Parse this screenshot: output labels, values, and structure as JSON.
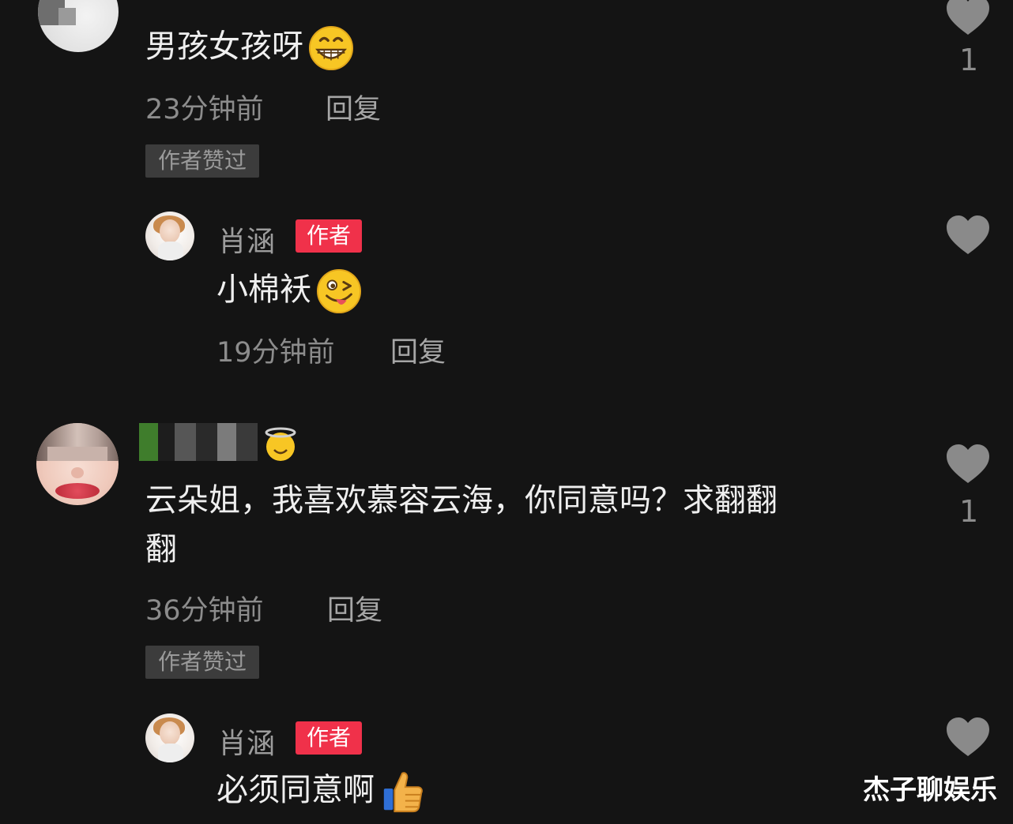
{
  "colors": {
    "background": "#141414",
    "author_badge": "#f0314a",
    "liked_badge": "#3c3c3c",
    "heart": "#8a8a8a"
  },
  "comments": [
    {
      "text": "男孩女孩呀",
      "emoji": "grinning-face-emoji",
      "time": "23分钟前",
      "reply_label": "回复",
      "liked_badge": "作者赞过",
      "like_count": "1"
    },
    {
      "name": "肖涵",
      "author_badge": "作者",
      "text": "小棉袄",
      "emoji": "winking-tongue-face-emoji",
      "time": "19分钟前",
      "reply_label": "回复"
    },
    {
      "text_line1": "云朵姐，我喜欢慕容云海，你同意吗？求翻翻",
      "text_line2": "翻",
      "time": "36分钟前",
      "reply_label": "回复",
      "liked_badge": "作者赞过",
      "like_count": "1"
    },
    {
      "name": "肖涵",
      "author_badge": "作者",
      "text": "必须同意啊",
      "emoji": "thumbs-up-emoji",
      "time": "",
      "reply_label": ""
    }
  ],
  "watermark": "杰子聊娱乐"
}
